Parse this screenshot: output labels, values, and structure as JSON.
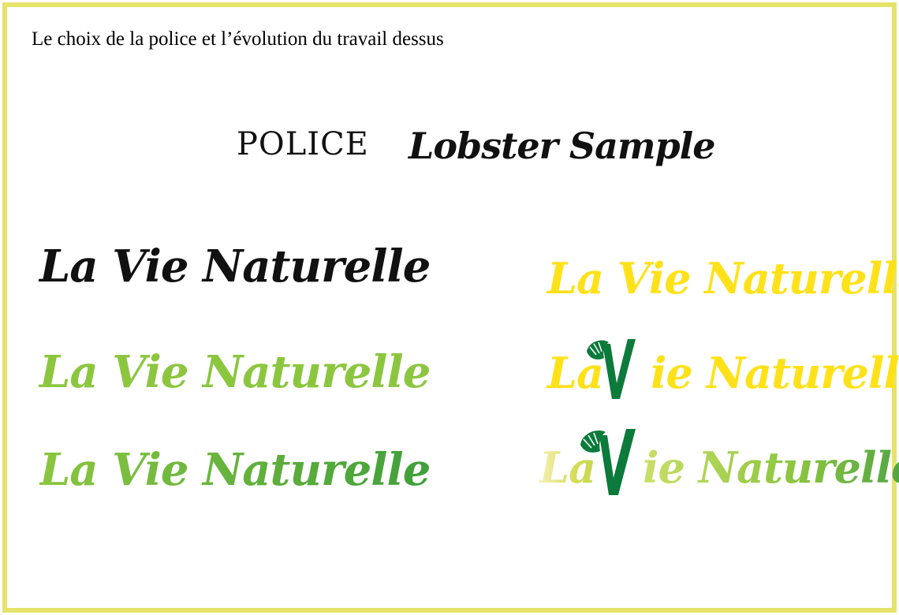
{
  "page": {
    "heading": "Le choix de la police et l’évolution du travail dessus",
    "font_label": "POLICE",
    "font_sample": "Lobster Sample"
  },
  "logos": {
    "black": "La Vie Naturelle",
    "green": "La Vie Naturelle",
    "green_gradient": "La Vie Naturelle",
    "yellow": "La Vie Naturelle",
    "yellow_icon_la": "La",
    "yellow_icon_rest": "ie Naturelle",
    "final_la": "La",
    "final_rest": "ie Naturelle"
  },
  "colors": {
    "frame": "#e6e36a",
    "black": "#111111",
    "green_light": "#8cc63f",
    "green_dark": "#3f9f3a",
    "yellow": "#ffe11a",
    "v_green": "#0b7a3b"
  },
  "icons": {
    "v_mark": "palm-leaf-v-icon"
  }
}
